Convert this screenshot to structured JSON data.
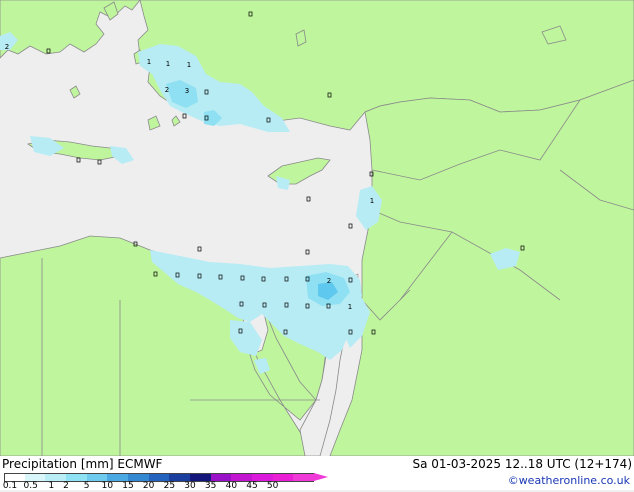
{
  "title": "Precipitation [mm] ECMWF",
  "valid_time": "Sa 01-03-2025 12..18 UTC (12+174)",
  "credit": "©weatheronline.co.uk",
  "colors": {
    "sea": "#eeeeee",
    "land": "#bff59d",
    "coast": "#8a8a8a",
    "border": "#8a8a8a",
    "precip_light": "#b7ecf5",
    "precip_mid": "#8ee0f2",
    "precip_heavy": "#5ec8ee"
  },
  "legend": {
    "ticks": [
      "0.1",
      "0.5",
      "1",
      "2",
      "5",
      "10",
      "15",
      "20",
      "25",
      "30",
      "35",
      "40",
      "45",
      "50"
    ],
    "colors": [
      "#ffffff",
      "#d9f6fb",
      "#b9eef7",
      "#8fe2f4",
      "#6fcbee",
      "#4aa9e2",
      "#3488d2",
      "#2464be",
      "#1a3f9e",
      "#14167c",
      "#9a12c8",
      "#c316d0",
      "#dc1adc",
      "#ea1fd6",
      "#f03ad8"
    ]
  },
  "point_labels": [
    "2",
    "1",
    "1",
    "1",
    "2",
    "3",
    "1",
    "2",
    "1"
  ]
}
